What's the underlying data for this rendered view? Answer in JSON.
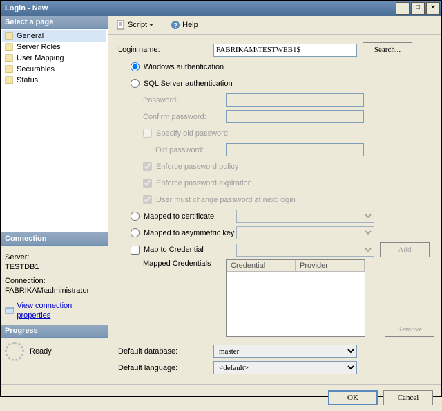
{
  "title": "Login - New",
  "sidebar": {
    "header": "Select a page",
    "items": [
      {
        "label": "General"
      },
      {
        "label": "Server Roles"
      },
      {
        "label": "User Mapping"
      },
      {
        "label": "Securables"
      },
      {
        "label": "Status"
      }
    ]
  },
  "connection": {
    "header": "Connection",
    "server_label": "Server:",
    "server_value": "TESTDB1",
    "conn_label": "Connection:",
    "conn_value": "FABRIKAM\\administrator",
    "link": "View connection properties"
  },
  "progress": {
    "header": "Progress",
    "status": "Ready"
  },
  "toolbar": {
    "script": "Script",
    "help": "Help"
  },
  "form": {
    "login_name_label": "Login name:",
    "login_name_value": "FABRIKAM\\TESTWEB1$",
    "search": "Search...",
    "auth_windows": "Windows authentication",
    "auth_sql": "SQL Server authentication",
    "password": "Password:",
    "confirm": "Confirm password:",
    "specify_old": "Specify old password",
    "old_password": "Old password:",
    "enforce_policy": "Enforce password policy",
    "enforce_exp": "Enforce password expiration",
    "must_change": "User must change password at next login",
    "mapped_cert": "Mapped to certificate",
    "mapped_asym": "Mapped to asymmetric key",
    "map_cred": "Map to Credential",
    "add": "Add",
    "mapped_creds": "Mapped Credentials",
    "col_cred": "Credential",
    "col_prov": "Provider",
    "remove": "Remove",
    "def_db": "Default database:",
    "def_db_val": "master",
    "def_lang": "Default language:",
    "def_lang_val": "<default>"
  },
  "footer": {
    "ok": "OK",
    "cancel": "Cancel"
  }
}
